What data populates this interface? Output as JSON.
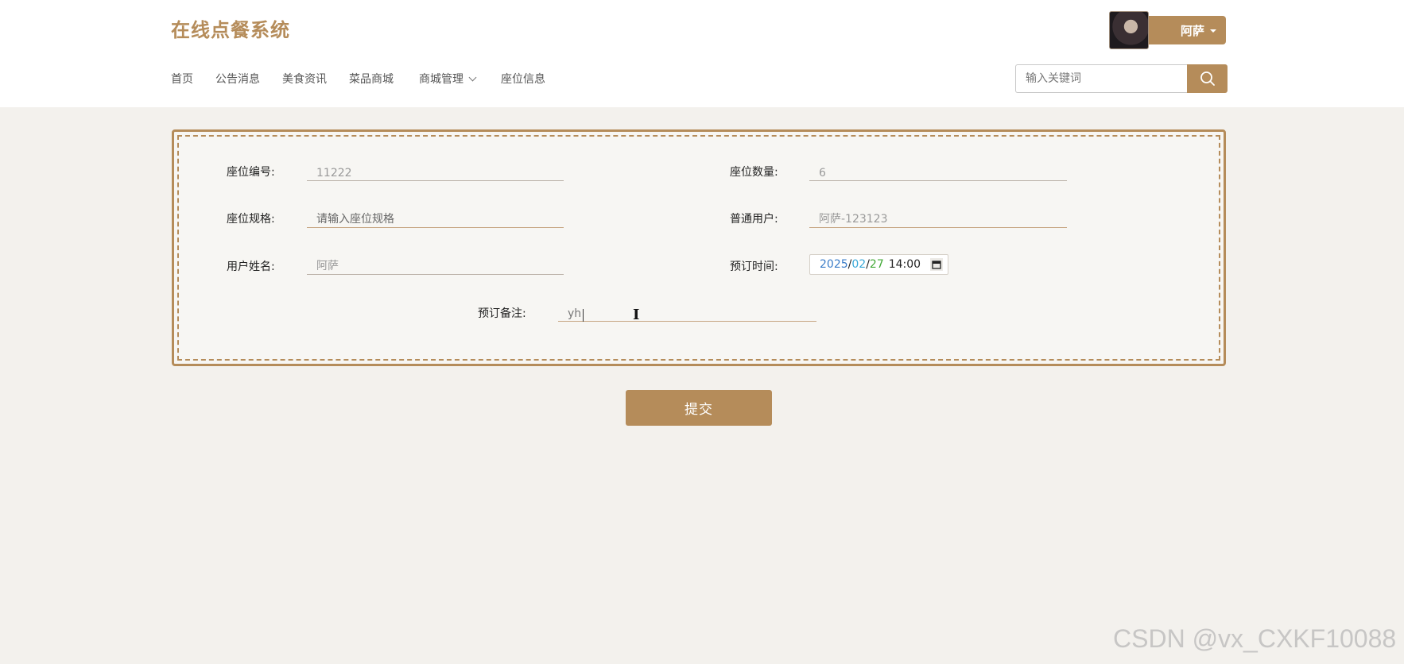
{
  "header": {
    "site_title": "在线点餐系统",
    "nav": [
      "首页",
      "公告消息",
      "美食资讯",
      "菜品商城",
      "商城管理",
      "座位信息"
    ],
    "user_name": "阿萨",
    "search_placeholder": "输入关键词"
  },
  "form": {
    "seat_no_label": "座位编号:",
    "seat_no_value": "11222",
    "seat_count_label": "座位数量:",
    "seat_count_value": "6",
    "seat_spec_label": "座位规格:",
    "seat_spec_placeholder": "请输入座位规格",
    "user_label": "普通用户:",
    "user_value": "阿萨-123123",
    "name_label": "用户姓名:",
    "name_value": "阿萨",
    "time_label": "预订时间:",
    "time_year": "2025",
    "time_month": "02",
    "time_day": "27",
    "time_clock": "14:00",
    "note_label": "预订备注:",
    "note_value": "yh"
  },
  "submit_label": "提交",
  "watermark": "CSDN @vx_CXKF10088",
  "colors": {
    "accent": "#b58c5a",
    "background": "#f3f1ed"
  }
}
